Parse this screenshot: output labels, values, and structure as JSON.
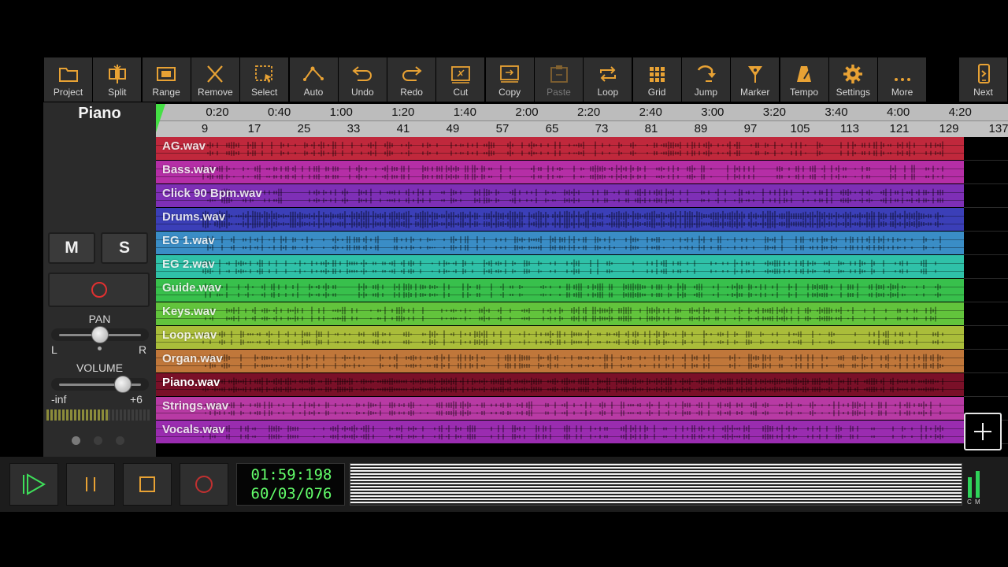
{
  "toolbar": {
    "items": [
      {
        "label": "Project",
        "icon": "folder-icon"
      },
      {
        "label": "Split",
        "icon": "split-icon"
      },
      {
        "label": "Range",
        "icon": "range-icon"
      },
      {
        "label": "Remove",
        "icon": "close-icon"
      },
      {
        "label": "Select",
        "icon": "select-icon"
      },
      {
        "label": "Auto",
        "icon": "automation-icon"
      },
      {
        "label": "Undo",
        "icon": "undo-icon"
      },
      {
        "label": "Redo",
        "icon": "redo-icon"
      },
      {
        "label": "Cut",
        "icon": "cut-icon"
      },
      {
        "label": "Copy",
        "icon": "copy-icon"
      },
      {
        "label": "Paste",
        "icon": "paste-icon",
        "disabled": true
      },
      {
        "label": "Loop",
        "icon": "loop-icon"
      },
      {
        "label": "Grid",
        "icon": "grid-icon"
      },
      {
        "label": "Jump",
        "icon": "jump-icon"
      },
      {
        "label": "Marker",
        "icon": "marker-icon"
      },
      {
        "label": "Tempo",
        "icon": "metronome-icon"
      },
      {
        "label": "Settings",
        "icon": "gear-icon"
      },
      {
        "label": "More",
        "icon": "more-icon"
      }
    ],
    "next": {
      "label": "Next",
      "icon": "phone-next-icon"
    }
  },
  "left_panel": {
    "track_name": "Piano",
    "mute_label": "M",
    "solo_label": "S",
    "pan_label": "PAN",
    "pan_left": "L",
    "pan_right": "R",
    "pan_value": 0.5,
    "volume_label": "VOLUME",
    "volume_min": "-inf",
    "volume_max": "+6",
    "volume_value": 0.78
  },
  "ruler": {
    "times": [
      "0:20",
      "0:40",
      "1:00",
      "1:20",
      "1:40",
      "2:00",
      "2:20",
      "2:40",
      "3:00",
      "3:20",
      "3:40",
      "4:00",
      "4:20"
    ],
    "bars": [
      "9",
      "17",
      "25",
      "33",
      "41",
      "49",
      "57",
      "65",
      "73",
      "81",
      "89",
      "97",
      "105",
      "113",
      "121",
      "129",
      "137"
    ]
  },
  "tracks": [
    {
      "name": "AG.wav",
      "color": "#c0283c"
    },
    {
      "name": "Bass.wav",
      "color": "#b52ea6"
    },
    {
      "name": "Click 90 Bpm.wav",
      "color": "#7e2fb6"
    },
    {
      "name": "Drums.wav",
      "color": "#3b3fb8"
    },
    {
      "name": "EG 1.wav",
      "color": "#3a8dc6"
    },
    {
      "name": "EG 2.wav",
      "color": "#2fc1a8"
    },
    {
      "name": "Guide.wav",
      "color": "#38c04c"
    },
    {
      "name": "Keys.wav",
      "color": "#62c43c"
    },
    {
      "name": "Loop.wav",
      "color": "#aabd3a"
    },
    {
      "name": "Organ.wav",
      "color": "#c0773a"
    },
    {
      "name": "Piano.wav",
      "color": "#7a1028",
      "selected": true
    },
    {
      "name": "Strings.wav",
      "color": "#b83aa4"
    },
    {
      "name": "Vocals.wav",
      "color": "#9a2cb0"
    }
  ],
  "transport": {
    "time": "01:59:198",
    "position": "60/03/076",
    "meter_labels": [
      "C",
      "M"
    ]
  }
}
